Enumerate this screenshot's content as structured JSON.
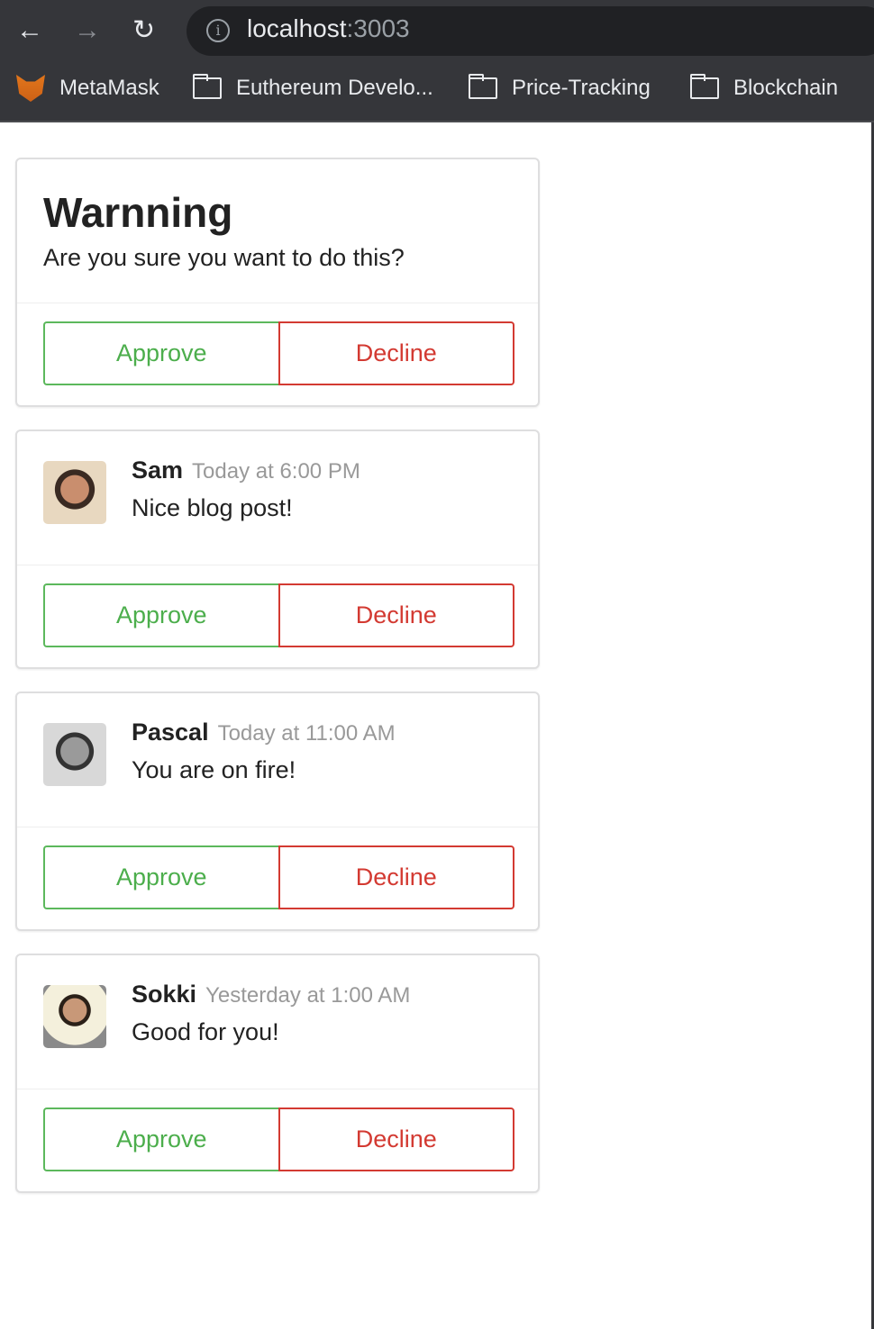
{
  "browser": {
    "url_host": "localhost",
    "url_port": ":3003",
    "bookmarks": [
      {
        "label": "MetaMask",
        "icon": "metamask-fox-icon"
      },
      {
        "label": "Euthereum Develo...",
        "icon": "folder-icon"
      },
      {
        "label": "Price-Tracking",
        "icon": "folder-icon"
      },
      {
        "label": "Blockchain",
        "icon": "folder-icon"
      }
    ]
  },
  "warning": {
    "title": "Warnning",
    "message": "Are you sure you want to do this?",
    "approve_label": "Approve",
    "decline_label": "Decline"
  },
  "comments": [
    {
      "author": "Sam",
      "time": "Today at 6:00 PM",
      "text": "Nice blog post!",
      "approve_label": "Approve",
      "decline_label": "Decline"
    },
    {
      "author": "Pascal",
      "time": "Today at 11:00 AM",
      "text": "You are on fire!",
      "approve_label": "Approve",
      "decline_label": "Decline"
    },
    {
      "author": "Sokki",
      "time": "Yesterday at 1:00 AM",
      "text": "Good for you!",
      "approve_label": "Approve",
      "decline_label": "Decline"
    }
  ],
  "colors": {
    "approve": "#5cb85c",
    "decline": "#d33a32"
  }
}
